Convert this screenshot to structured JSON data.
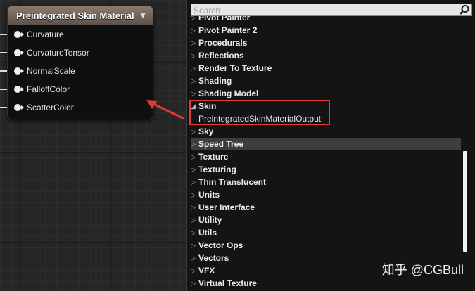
{
  "node": {
    "title": "Preintegrated Skin Material",
    "pins": [
      "Curvature",
      "CurvatureTensor",
      "NormalScale",
      "FalloffColor",
      "ScatterColor"
    ]
  },
  "panel": {
    "search_placeholder": "Search",
    "partial_top": "Pivot Painter",
    "categories_before": [
      "Pivot Painter 2",
      "Procedurals",
      "Reflections",
      "Render To Texture",
      "Shading",
      "Shading Model"
    ],
    "expanded": {
      "label": "Skin",
      "child": "PreintegratedSkinMaterialOutput"
    },
    "categories_after": [
      "Sky",
      "Speed Tree",
      "Texture",
      "Texturing",
      "Thin Translucent",
      "Units",
      "User Interface",
      "Utility",
      "Utils",
      "Vector Ops",
      "Vectors",
      "VFX"
    ],
    "partial_bottom": "Virtual Texture",
    "selected": "Speed Tree"
  },
  "watermark": "知乎 @CGBull",
  "colors": {
    "highlight": "#e23a3a",
    "header": "#6e625a"
  }
}
